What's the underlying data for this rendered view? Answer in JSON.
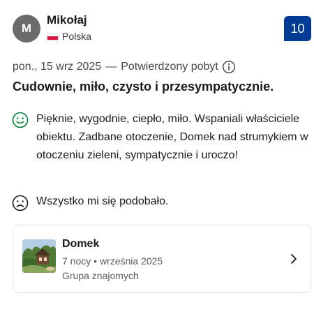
{
  "reviewer": {
    "initial": "M",
    "name": "Mikołaj",
    "country": "Polska",
    "flag_colors": [
      "#ffffff",
      "#dc143c"
    ]
  },
  "score": "10",
  "review": {
    "date": "pon., 15 wrz 2025",
    "separator": "—",
    "verified_label": "Potwierdzony pobyt",
    "title": "Cudownie, miło, czysto i przesympatycznie.",
    "positive": "Pięknie, wygodnie, ciepło, miło. Wspaniali właściciele obiektu. Zadbane otoczenie, Domek nad strumykiem w otoczeniu zieleni, sympatycznie i uroczo!",
    "negative": "Wszystko mi się podobało."
  },
  "stay": {
    "room_name": "Domek",
    "nights": "7 nocy",
    "dot": "•",
    "month": "września 2025",
    "traveler_type": "Grupa znajomych"
  },
  "colors": {
    "score_bg": "#003b95",
    "positive_icon": "#008234",
    "negative_icon": "#1a1a1a"
  },
  "icons": {
    "info": "info-circle-icon",
    "positive": "smile-icon",
    "negative": "frown-icon",
    "chevron": "chevron-right-icon"
  }
}
